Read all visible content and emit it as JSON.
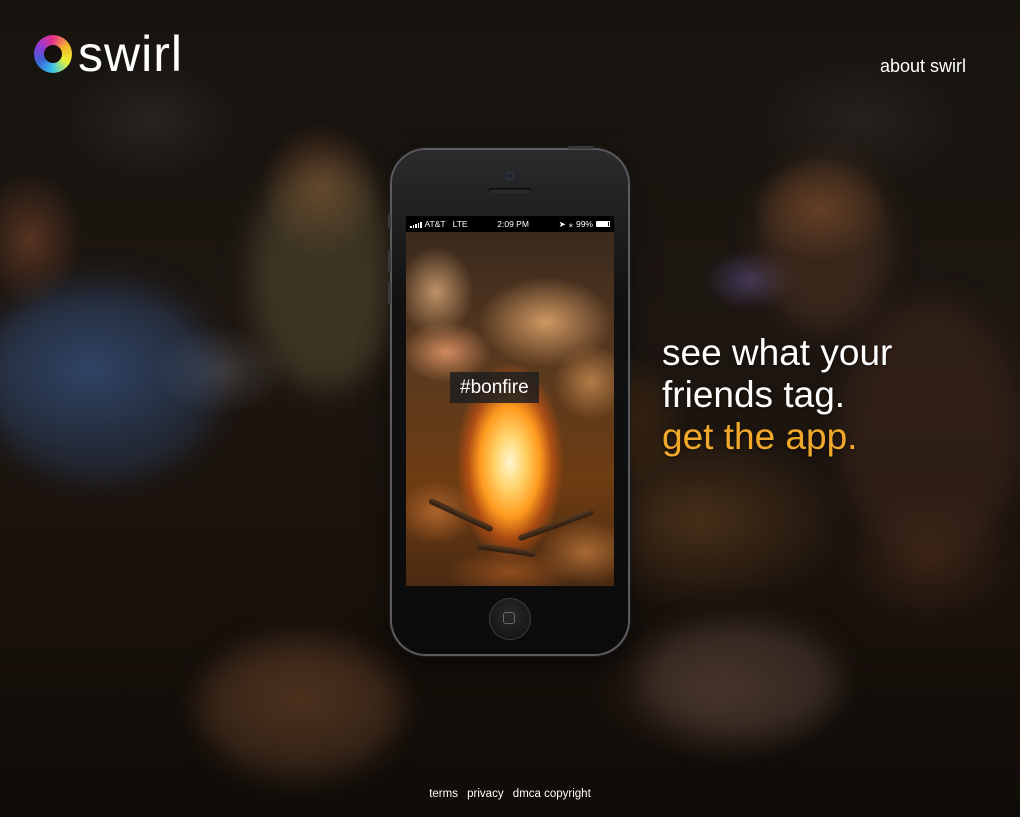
{
  "brand": {
    "name": "swirl",
    "logo_icon": "swirl-ring-logo",
    "ring_colors": [
      "#e6338a",
      "#f4b52b",
      "#eaf236",
      "#3ac7e9",
      "#3a64d8",
      "#8d3bd6"
    ]
  },
  "nav": {
    "about_label": "about swirl"
  },
  "phone": {
    "status_bar": {
      "carrier": "AT&T",
      "network": "LTE",
      "time": "2:09 PM",
      "battery": "99%",
      "icons": [
        "signal-bars-icon",
        "location-arrow-icon",
        "bluetooth-icon",
        "battery-icon"
      ]
    },
    "photo_subject": "campfire",
    "hashtag": "#bonfire"
  },
  "tagline": {
    "line1": "see what your",
    "line2": "friends tag.",
    "cta": "get the app.",
    "cta_color": "#f0a92a"
  },
  "footer": {
    "links": [
      "terms",
      "privacy",
      "dmca copyright"
    ]
  }
}
